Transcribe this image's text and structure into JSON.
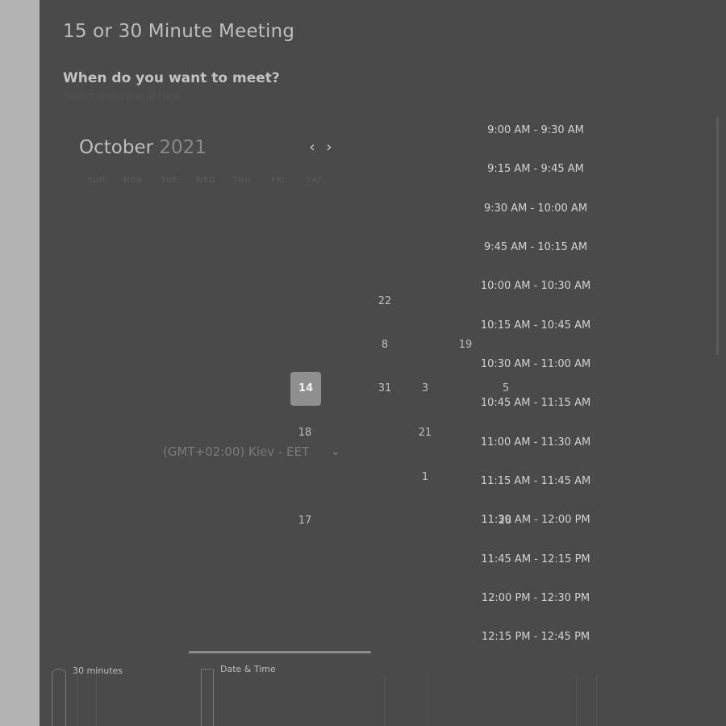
{
  "meeting": {
    "title": "15 or 30 Minute Meeting",
    "question": "When do you want to meet?",
    "hint": "Select a date and time"
  },
  "calendar": {
    "month": "October",
    "year": "2021",
    "prev_icon": "chevron-left-icon",
    "next_icon": "chevron-right-icon",
    "weekdays": [
      "SUN",
      "MON",
      "TUE",
      "WED",
      "THU",
      "FRI",
      "SAT"
    ],
    "days": [
      "22",
      "8",
      "19",
      "14",
      "31",
      "3",
      "5",
      "18",
      "21",
      "1",
      "17",
      "28"
    ],
    "selected_day": "14"
  },
  "timezone": {
    "label": "(GMT+02:00) Kiev - EET",
    "icon": "chevron-down-icon"
  },
  "slots": [
    "9:00 AM - 9:30 AM",
    "9:15 AM - 9:45 AM",
    "9:30 AM - 10:00 AM",
    "9:45 AM - 10:15 AM",
    "10:00 AM - 10:30 AM",
    "10:15 AM - 10:45 AM",
    "10:30 AM - 11:00 AM",
    "10:45 AM - 11:15 AM",
    "11:00 AM - 11:30 AM",
    "11:15 AM - 11:45 AM",
    "11:30 AM - 12:00 PM",
    "11:45 AM - 12:15 PM",
    "12:00 PM - 12:30 PM",
    "12:15 PM - 12:45 PM"
  ],
  "steps": {
    "duration": "30 minutes",
    "datetime": "Date & Time"
  },
  "colors": {
    "overlay": "#4a4a4a",
    "page_bg": "#b3b3b3",
    "selected_day": "#8f8f8f"
  }
}
